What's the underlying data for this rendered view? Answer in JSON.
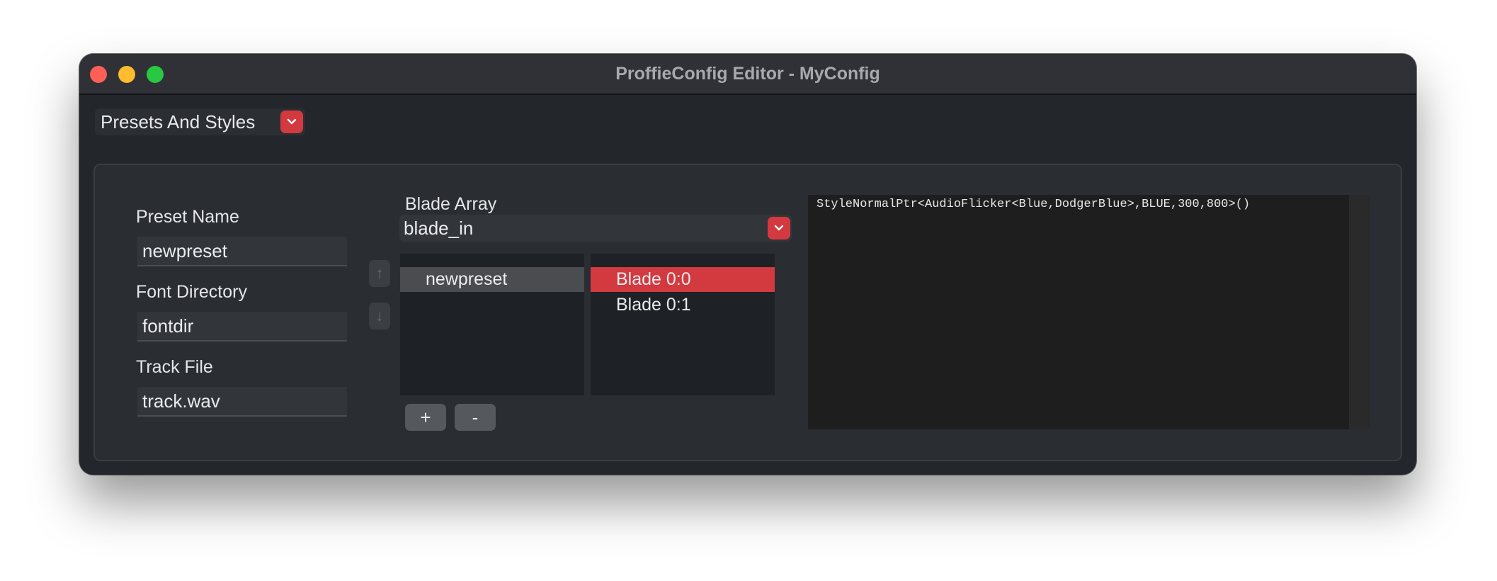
{
  "window": {
    "title": "ProffieConfig Editor - MyConfig"
  },
  "page_selector": {
    "selected": "Presets And Styles"
  },
  "preset_fields": {
    "preset_name_label": "Preset Name",
    "preset_name_value": "newpreset",
    "font_dir_label": "Font Directory",
    "font_dir_value": "fontdir",
    "track_label": "Track File",
    "track_value": "track.wav"
  },
  "move_buttons": {
    "up_icon": "arrow-up-icon",
    "down_icon": "arrow-down-icon"
  },
  "blade_array": {
    "label": "Blade Array",
    "selected": "blade_in"
  },
  "presets_list": {
    "items": [
      "newpreset"
    ],
    "selected_index": 0
  },
  "blades_list": {
    "items": [
      "Blade 0:0",
      "Blade 0:1"
    ],
    "selected_index": 0
  },
  "list_buttons": {
    "add": "+",
    "remove": "-"
  },
  "style_editor": {
    "text": "StyleNormalPtr<AudioFlicker<Blue,DodgerBlue>,BLUE,300,800>()"
  },
  "colors": {
    "accent": "#d33a3f",
    "window_bg": "#23262b",
    "list_bg": "#1e2125"
  }
}
